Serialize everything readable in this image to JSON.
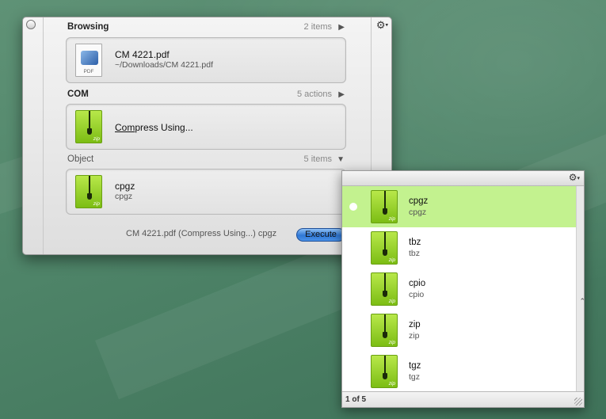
{
  "browsing": {
    "title": "Browsing",
    "count": "2 items",
    "item": {
      "name": "CM 4221.pdf",
      "path": "~/Downloads/CM 4221.pdf",
      "icon": "pdf-file-icon"
    }
  },
  "action": {
    "title": "COM",
    "count": "5 actions",
    "label_match": "Com",
    "label_rest": "press Using...",
    "icon": "zip-archive-icon"
  },
  "object": {
    "title": "Object",
    "count": "5 items",
    "item": {
      "name": "cpgz",
      "sub": "cpgz",
      "icon": "zip-archive-icon"
    }
  },
  "command": {
    "summary": "CM 4221.pdf (Compress Using...) cpgz",
    "execute_label": "Execute"
  },
  "icons": {
    "pdf_label": "PDF",
    "zip_label": "zip",
    "gear": "gear-icon",
    "arrow_right": "▶",
    "arrow_down": "▼"
  },
  "results": {
    "items": [
      {
        "name": "cpgz",
        "sub": "cpgz"
      },
      {
        "name": "tbz",
        "sub": "tbz"
      },
      {
        "name": "cpio",
        "sub": "cpio"
      },
      {
        "name": "zip",
        "sub": "zip"
      },
      {
        "name": "tgz",
        "sub": "tgz"
      }
    ],
    "selected_index": 0,
    "footer": "1 of 5"
  },
  "colors": {
    "selection": "#c3f28f",
    "zip_green": "#8ccc1f",
    "execute_blue": "#2f78d6",
    "desktop_green": "#4e8468"
  }
}
